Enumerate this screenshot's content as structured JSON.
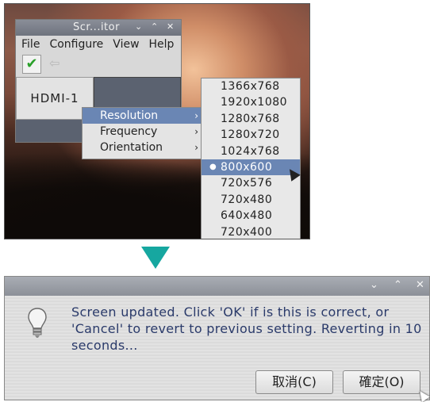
{
  "top_window": {
    "title": "Scr...itor",
    "controls": [
      "⌄",
      "⌃",
      "✕"
    ],
    "menu": [
      "File",
      "Configure",
      "View",
      "Help"
    ],
    "monitor_label": "HDMI-1"
  },
  "context_menu": {
    "items": [
      {
        "label": "Resolution",
        "active": true
      },
      {
        "label": "Frequency",
        "active": false
      },
      {
        "label": "Orientation",
        "active": false
      }
    ],
    "arrow": "›"
  },
  "resolution_menu": {
    "options": [
      "1366x768",
      "1920x1080",
      "1280x768",
      "1280x720",
      "1024x768",
      "800x600",
      "720x576",
      "720x480",
      "640x480",
      "720x400"
    ],
    "selected": "800x600"
  },
  "dialog": {
    "controls": [
      "⌄",
      "⌃",
      "✕"
    ],
    "message": "Screen updated. Click 'OK' if is this is correct, or 'Cancel' to revert to previous setting. Reverting in 10 seconds...",
    "cancel_label": "取消(C)",
    "ok_label": "確定(O)"
  },
  "colors": {
    "arrow": "#16a7a0",
    "highlight": "#6a86b4",
    "message_text": "#2a3a6a"
  }
}
